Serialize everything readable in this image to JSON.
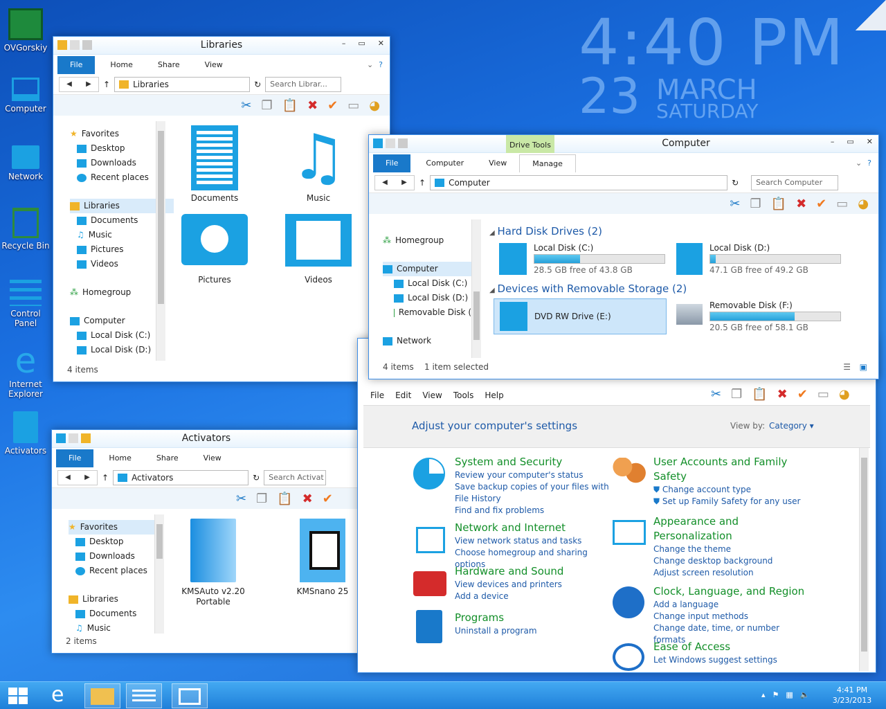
{
  "clock": {
    "time": "4:40 PM",
    "day": "23",
    "month": "MARCH",
    "weekday": "SATURDAY"
  },
  "desktop_icons": [
    {
      "label": "OVGorskiy",
      "icon": "user-folder-icon"
    },
    {
      "label": "Computer",
      "icon": "computer-icon"
    },
    {
      "label": "Network",
      "icon": "network-icon"
    },
    {
      "label": "Recycle Bin",
      "icon": "recycle-bin-icon"
    },
    {
      "label": "Control Panel",
      "icon": "control-panel-icon"
    },
    {
      "label": "Internet Explorer",
      "icon": "internet-explorer-icon"
    },
    {
      "label": "Activators",
      "icon": "folder-icon"
    }
  ],
  "common": {
    "tabs": {
      "file": "File",
      "home": "Home",
      "share": "Share",
      "view": "View"
    },
    "nav_back": "◀",
    "nav_fwd": "▶",
    "nav_up": "↑"
  },
  "libraries": {
    "title": "Libraries",
    "address": "Libraries",
    "search_placeholder": "Search Librar...",
    "nav": {
      "favorites": "Favorites",
      "desktop": "Desktop",
      "downloads": "Downloads",
      "recent": "Recent places",
      "libraries": "Libraries",
      "documents": "Documents",
      "music": "Music",
      "pictures": "Pictures",
      "videos": "Videos",
      "homegroup": "Homegroup",
      "computer": "Computer",
      "local_c": "Local Disk (C:)",
      "local_d": "Local Disk (D:)"
    },
    "items": [
      "Documents",
      "Music",
      "Pictures",
      "Videos"
    ],
    "status": "4 items"
  },
  "activators": {
    "title": "Activators",
    "address": "Activators",
    "search_placeholder": "Search Activat",
    "nav": {
      "favorites": "Favorites",
      "desktop": "Desktop",
      "downloads": "Downloads",
      "recent": "Recent places",
      "libraries": "Libraries",
      "documents": "Documents",
      "music": "Music"
    },
    "items": [
      "KMSAuto v2.20 Portable",
      "KMSnano 25"
    ],
    "status": "2 items"
  },
  "computer": {
    "title": "Computer",
    "drive_tools": "Drive Tools",
    "tabs": {
      "file": "File",
      "computer": "Computer",
      "view": "View",
      "manage": "Manage"
    },
    "address": "Computer",
    "search_placeholder": "Search Computer",
    "nav": {
      "homegroup": "Homegroup",
      "computer": "Computer",
      "local_c": "Local Disk (C:)",
      "local_d": "Local Disk (D:)",
      "removable": "Removable Disk (",
      "network": "Network"
    },
    "hdd_group": "Hard Disk Drives (2)",
    "removable_group": "Devices with Removable Storage (2)",
    "drives": [
      {
        "name": "Local Disk (C:)",
        "free": "28.5 GB free of 43.8 GB",
        "used_fraction": 0.35
      },
      {
        "name": "Local Disk (D:)",
        "free": "47.1 GB free of 49.2 GB",
        "used_fraction": 0.04
      },
      {
        "name": "DVD RW Drive (E:)"
      },
      {
        "name": "Removable Disk (F:)",
        "free": "20.5 GB free of 58.1 GB",
        "used_fraction": 0.65
      }
    ],
    "status_items": "4 items",
    "status_selected": "1 item selected"
  },
  "control_panel": {
    "menu": [
      "File",
      "Edit",
      "View",
      "Tools",
      "Help"
    ],
    "heading": "Adjust your computer's settings",
    "view_by": "View by:",
    "view_mode": "Category",
    "categories": [
      {
        "title": "System and Security",
        "links": [
          "Review your computer's status",
          "Save backup copies of your files with File History",
          "Find and fix problems"
        ]
      },
      {
        "title": "Network and Internet",
        "links": [
          "View network status and tasks",
          "Choose homegroup and sharing options"
        ]
      },
      {
        "title": "Hardware and Sound",
        "links": [
          "View devices and printers",
          "Add a device"
        ]
      },
      {
        "title": "Programs",
        "links": [
          "Uninstall a program"
        ]
      },
      {
        "title": "User Accounts and Family Safety",
        "links": [
          "Change account type",
          "Set up Family Safety for any user"
        ]
      },
      {
        "title": "Appearance and Personalization",
        "links": [
          "Change the theme",
          "Change desktop background",
          "Adjust screen resolution"
        ]
      },
      {
        "title": "Clock, Language, and Region",
        "links": [
          "Add a language",
          "Change input methods",
          "Change date, time, or number formats"
        ]
      },
      {
        "title": "Ease of Access",
        "links": [
          "Let Windows suggest settings"
        ]
      }
    ]
  },
  "taskbar": {
    "time": "4:41 PM",
    "date": "3/23/2013"
  },
  "colors": {
    "accent": "#1979ca",
    "link": "#1e5aa8",
    "category_title": "#138f29",
    "drive_bar": "#26a0da"
  }
}
